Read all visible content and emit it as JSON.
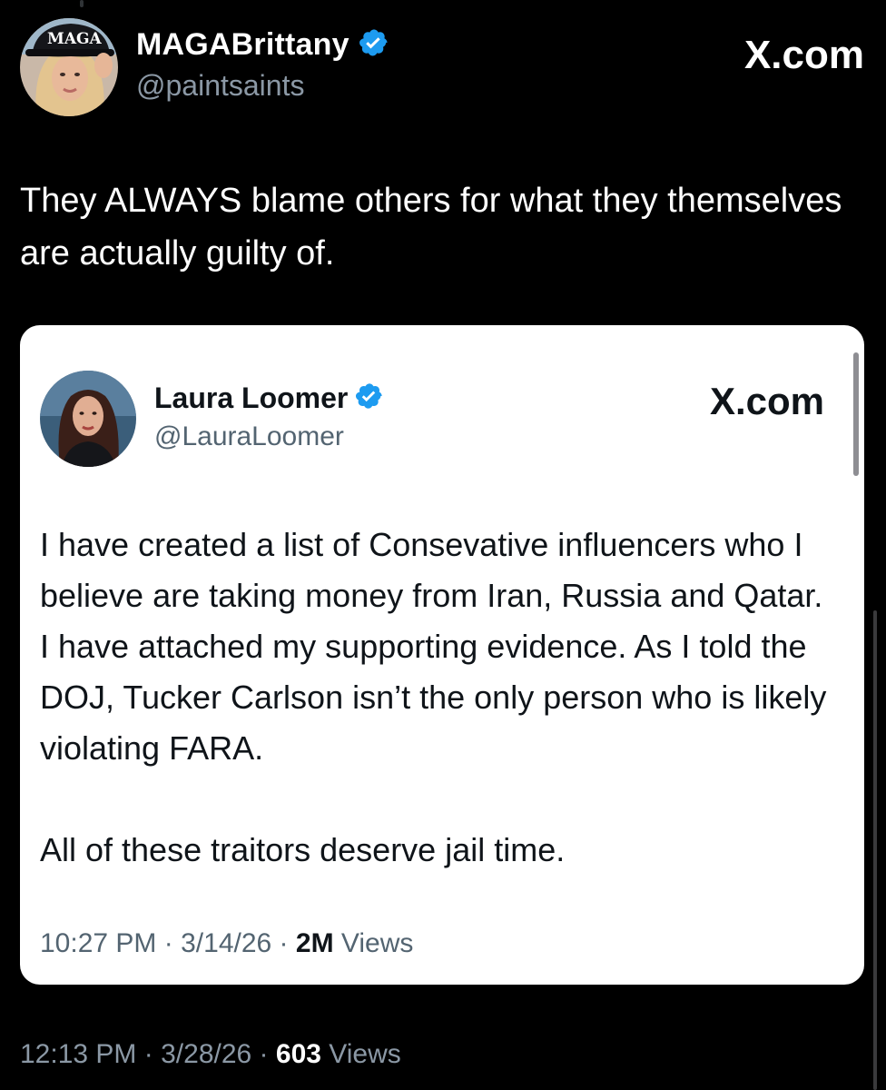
{
  "outer_tweet": {
    "author_name": "MAGABrittany",
    "author_handle": "@paintsaints",
    "avatar_icon": "profile-photo",
    "avatar_hat_text": "MAGA",
    "verified_icon": "verified-badge-icon",
    "verified_color": "#1d9bf0",
    "brand": "X.com",
    "text": "They ALWAYS blame others for what they themselves are actually guilty of.",
    "time": "12:13 PM",
    "date": "3/28/26",
    "views_count": "603",
    "views_label": "Views",
    "separator": "·"
  },
  "quoted_tweet": {
    "author_name": "Laura Loomer",
    "author_handle": "@LauraLoomer",
    "avatar_icon": "profile-photo",
    "verified_icon": "verified-badge-icon",
    "brand": "X.com",
    "paragraph_1": "I have created a list of Consevative influencers who I believe are taking money from Iran, Russia and Qatar. I have attached my supporting evidence. As I told the DOJ, Tucker Carlson isn’t the only person who is likely violating FARA.",
    "paragraph_2": "All of these traitors deserve jail time.",
    "time": "10:27 PM",
    "date": "3/14/26",
    "views_count": "2M",
    "views_label": "Views",
    "separator": "·"
  },
  "colors": {
    "background": "#000000",
    "card_background": "#ffffff",
    "muted_text_dark": "#8b98a5",
    "muted_text_light": "#536471"
  }
}
